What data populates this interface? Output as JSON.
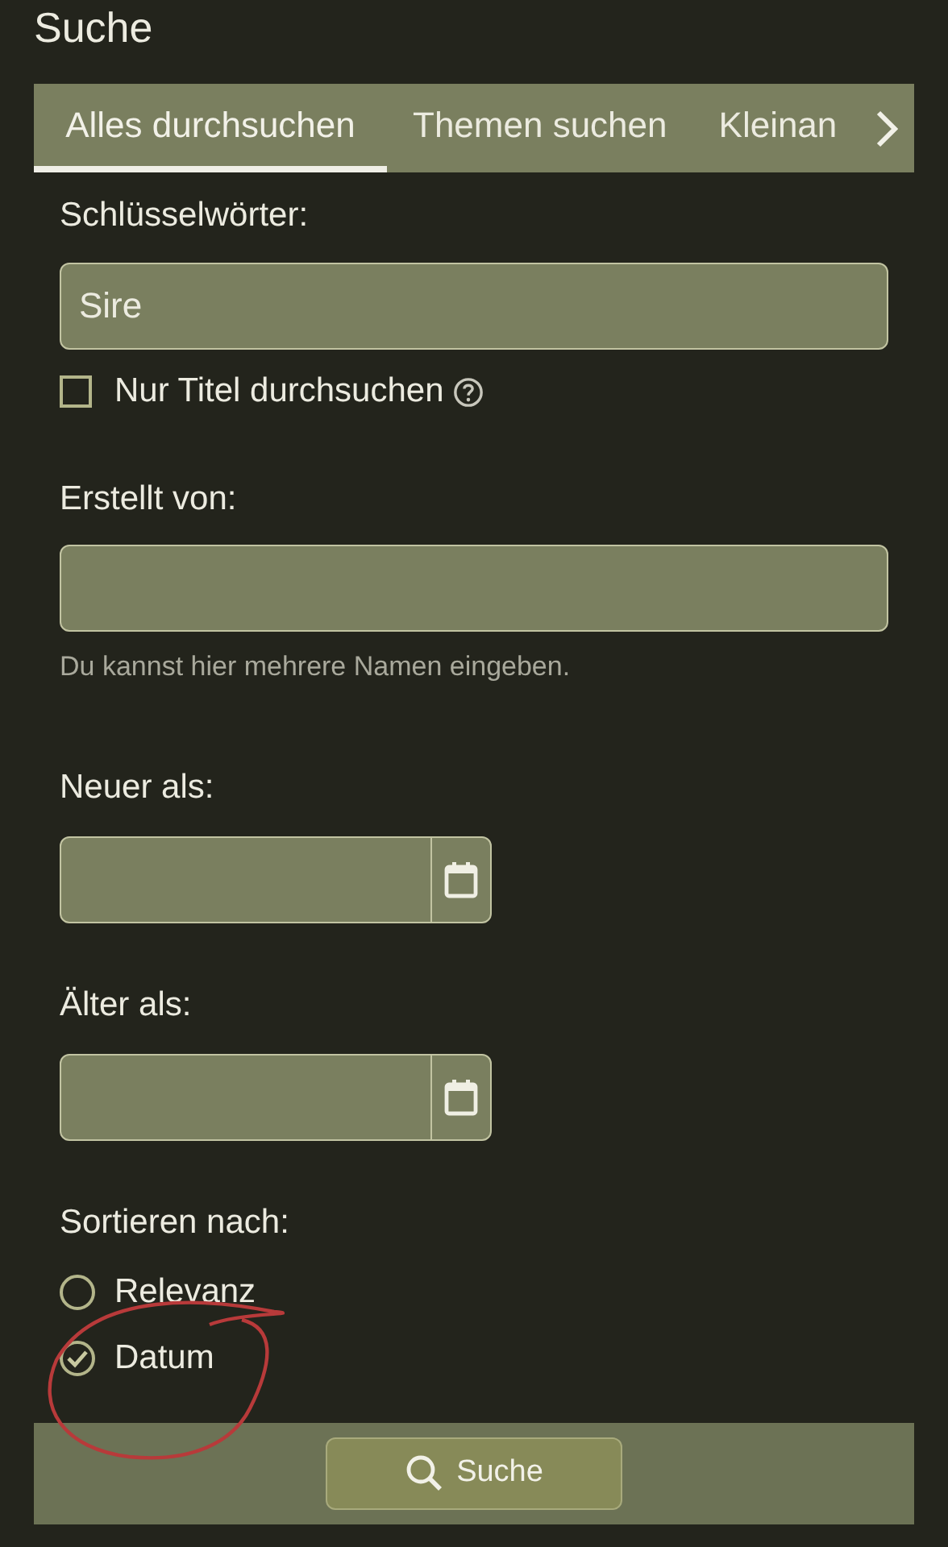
{
  "title": "Suche",
  "tabs": [
    {
      "label": "Alles durchsuchen",
      "selected": true
    },
    {
      "label": "Themen suchen",
      "selected": false
    },
    {
      "label": "Kleinan",
      "selected": false
    }
  ],
  "keywords": {
    "label": "Schlüsselwörter:",
    "value": "Sire"
  },
  "title_only": {
    "label": "Nur Titel durchsuchen",
    "checked": false
  },
  "created_by": {
    "label": "Erstellt von:",
    "hint": "Du kannst hier mehrere Namen eingeben."
  },
  "newer_than": {
    "label": "Neuer als:"
  },
  "older_than": {
    "label": "Älter als:"
  },
  "sort": {
    "label": "Sortieren nach:",
    "options": [
      {
        "label": "Relevanz",
        "selected": false
      },
      {
        "label": "Datum",
        "selected": true
      }
    ]
  },
  "submit": {
    "label": "Suche"
  }
}
